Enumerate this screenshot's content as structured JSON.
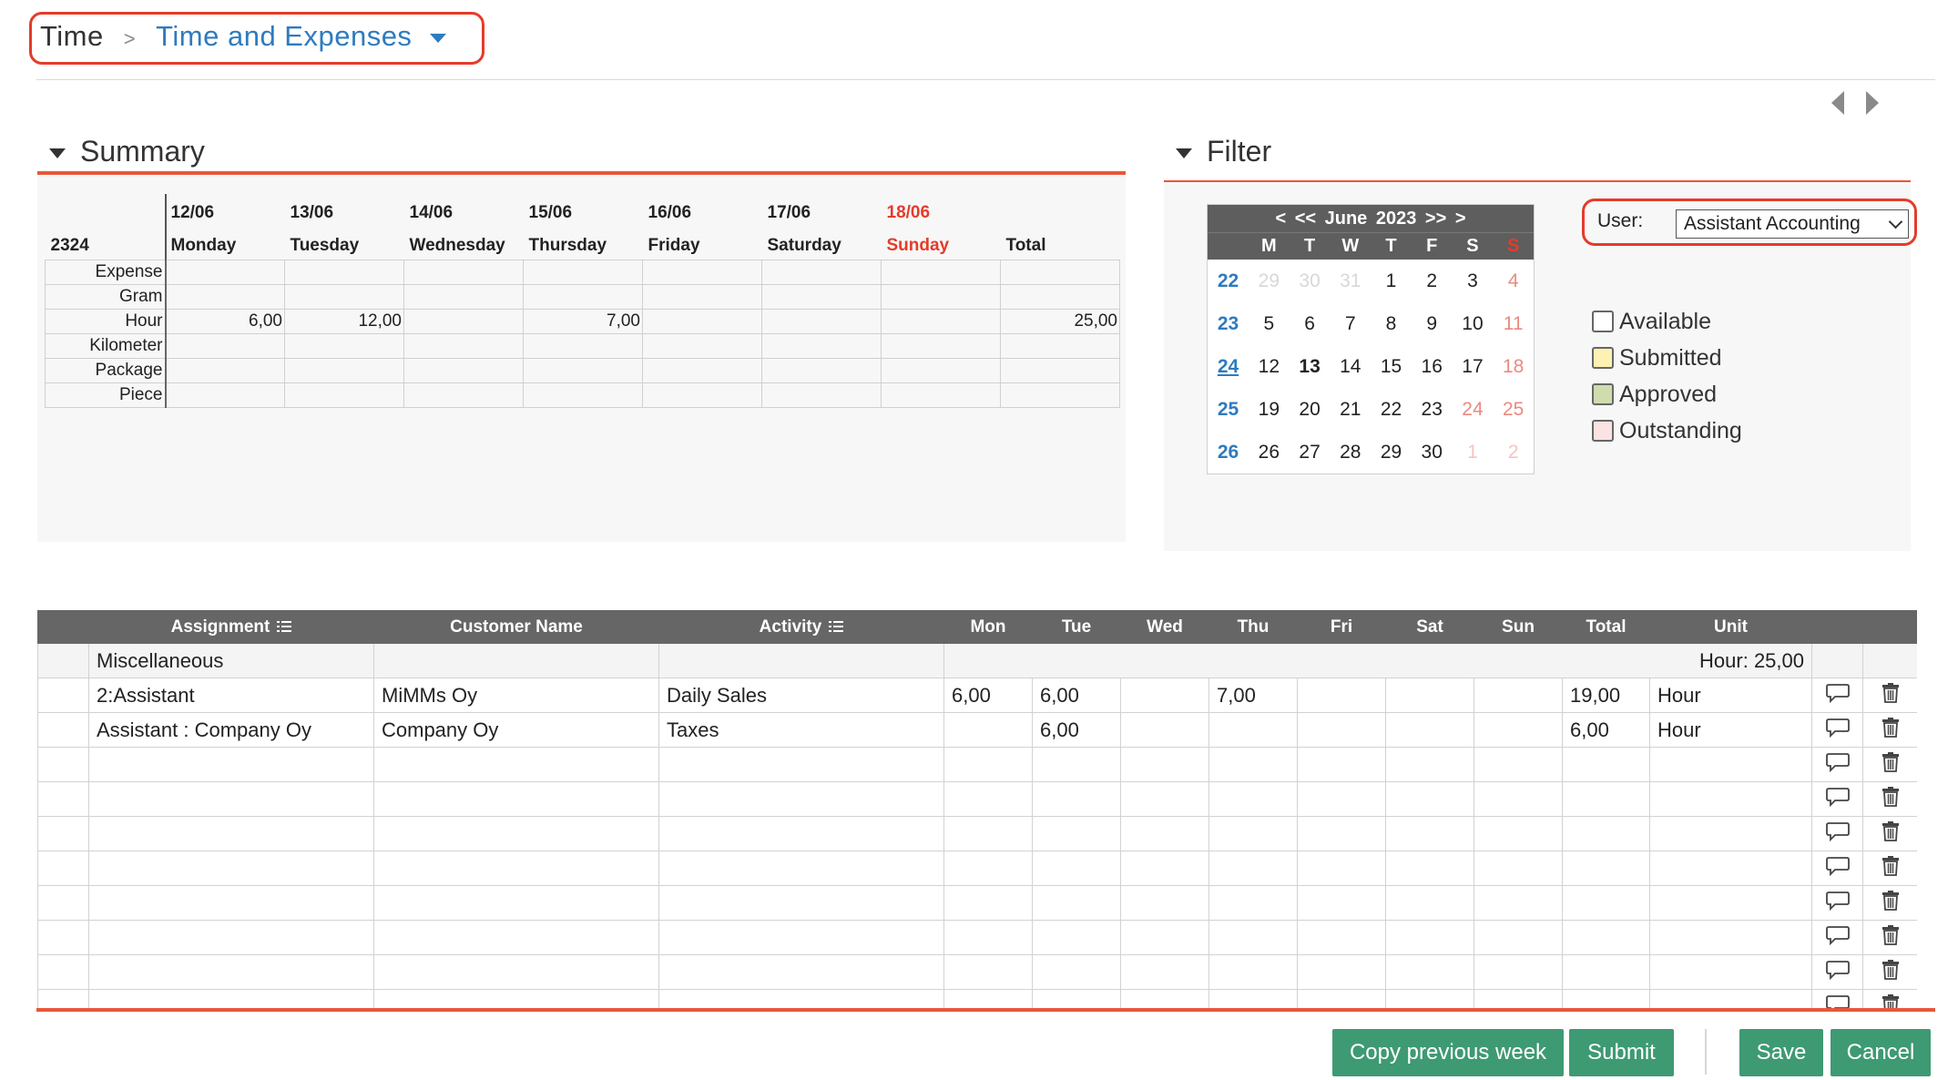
{
  "breadcrumb": {
    "root": "Time",
    "separator": ">",
    "current": "Time and Expenses"
  },
  "summary": {
    "title": "Summary",
    "week_label": "2324",
    "columns": [
      {
        "date": "12/06",
        "day": "Monday",
        "sunday": false
      },
      {
        "date": "13/06",
        "day": "Tuesday",
        "sunday": false
      },
      {
        "date": "14/06",
        "day": "Wednesday",
        "sunday": false
      },
      {
        "date": "15/06",
        "day": "Thursday",
        "sunday": false
      },
      {
        "date": "16/06",
        "day": "Friday",
        "sunday": false
      },
      {
        "date": "17/06",
        "day": "Saturday",
        "sunday": false
      },
      {
        "date": "18/06",
        "day": "Sunday",
        "sunday": true
      },
      {
        "date": "",
        "day": "Total",
        "sunday": false
      }
    ],
    "rows": [
      {
        "label": "Expense",
        "values": [
          "",
          "",
          "",
          "",
          "",
          "",
          "",
          ""
        ]
      },
      {
        "label": "Gram",
        "values": [
          "",
          "",
          "",
          "",
          "",
          "",
          "",
          ""
        ]
      },
      {
        "label": "Hour",
        "values": [
          "6,00",
          "12,00",
          "",
          "7,00",
          "",
          "",
          "",
          "25,00"
        ]
      },
      {
        "label": "Kilometer",
        "values": [
          "",
          "",
          "",
          "",
          "",
          "",
          "",
          ""
        ]
      },
      {
        "label": "Package",
        "values": [
          "",
          "",
          "",
          "",
          "",
          "",
          "",
          ""
        ]
      },
      {
        "label": "Piece",
        "values": [
          "",
          "",
          "",
          "",
          "",
          "",
          "",
          ""
        ]
      }
    ]
  },
  "filter": {
    "title": "Filter",
    "calendar": {
      "header": "< << June 2023 >> >",
      "dow": [
        "M",
        "T",
        "W",
        "T",
        "F",
        "S",
        "S"
      ],
      "weeks": [
        {
          "wk": "22",
          "current": false,
          "days": [
            [
              "29",
              "dim"
            ],
            [
              "30",
              "dim"
            ],
            [
              "31",
              "dim"
            ],
            [
              "1",
              ""
            ],
            [
              "2",
              ""
            ],
            [
              "3",
              ""
            ],
            [
              "4",
              "wkend"
            ]
          ]
        },
        {
          "wk": "23",
          "current": false,
          "days": [
            [
              "5",
              ""
            ],
            [
              "6",
              ""
            ],
            [
              "7",
              ""
            ],
            [
              "8",
              ""
            ],
            [
              "9",
              ""
            ],
            [
              "10",
              ""
            ],
            [
              "11",
              "wkend"
            ]
          ]
        },
        {
          "wk": "24",
          "current": true,
          "days": [
            [
              "12",
              ""
            ],
            [
              "13",
              "today"
            ],
            [
              "14",
              ""
            ],
            [
              "15",
              ""
            ],
            [
              "16",
              ""
            ],
            [
              "17",
              ""
            ],
            [
              "18",
              "wkend"
            ]
          ]
        },
        {
          "wk": "25",
          "current": false,
          "days": [
            [
              "19",
              ""
            ],
            [
              "20",
              ""
            ],
            [
              "21",
              ""
            ],
            [
              "22",
              ""
            ],
            [
              "23",
              ""
            ],
            [
              "24",
              "wkend"
            ],
            [
              "25",
              "wkend"
            ]
          ]
        },
        {
          "wk": "26",
          "current": false,
          "days": [
            [
              "26",
              ""
            ],
            [
              "27",
              ""
            ],
            [
              "28",
              ""
            ],
            [
              "29",
              ""
            ],
            [
              "30",
              ""
            ],
            [
              "1",
              "dimred"
            ],
            [
              "2",
              "dimred"
            ]
          ]
        }
      ]
    },
    "user_label": "User:",
    "user_value": "Assistant Accounting",
    "legend": [
      {
        "label": "Available",
        "color": "#ffffff"
      },
      {
        "label": "Submitted",
        "color": "#fdf1b3"
      },
      {
        "label": "Approved",
        "color": "#cfdcae"
      },
      {
        "label": "Outstanding",
        "color": "#fbe2e3"
      }
    ]
  },
  "grid": {
    "headers": [
      "Assignment",
      "Customer Name",
      "Activity",
      "Mon",
      "Tue",
      "Wed",
      "Thu",
      "Fri",
      "Sat",
      "Sun",
      "Total",
      "Unit"
    ],
    "misc_row": {
      "label": "Miscellaneous",
      "summary": "Hour: 25,00"
    },
    "rows": [
      {
        "assignment": "2:Assistant",
        "customer": "MiMMs Oy",
        "activity": "Daily Sales",
        "days": [
          "6,00",
          "6,00",
          "",
          "7,00",
          "",
          "",
          ""
        ],
        "total": "19,00",
        "unit": "Hour"
      },
      {
        "assignment": "Assistant : Company Oy",
        "customer": "Company Oy",
        "activity": "Taxes",
        "days": [
          "",
          "6,00",
          "",
          "",
          "",
          "",
          ""
        ],
        "total": "6,00",
        "unit": "Hour"
      }
    ],
    "empty_rows": 8
  },
  "buttons": {
    "copy_previous_week": "Copy previous week",
    "submit": "Submit",
    "save": "Save",
    "cancel": "Cancel"
  },
  "colors": {
    "accent": "#e8573a",
    "link": "#2e7bbf",
    "button": "#3e9a73",
    "highlight": "#e53b2a"
  }
}
